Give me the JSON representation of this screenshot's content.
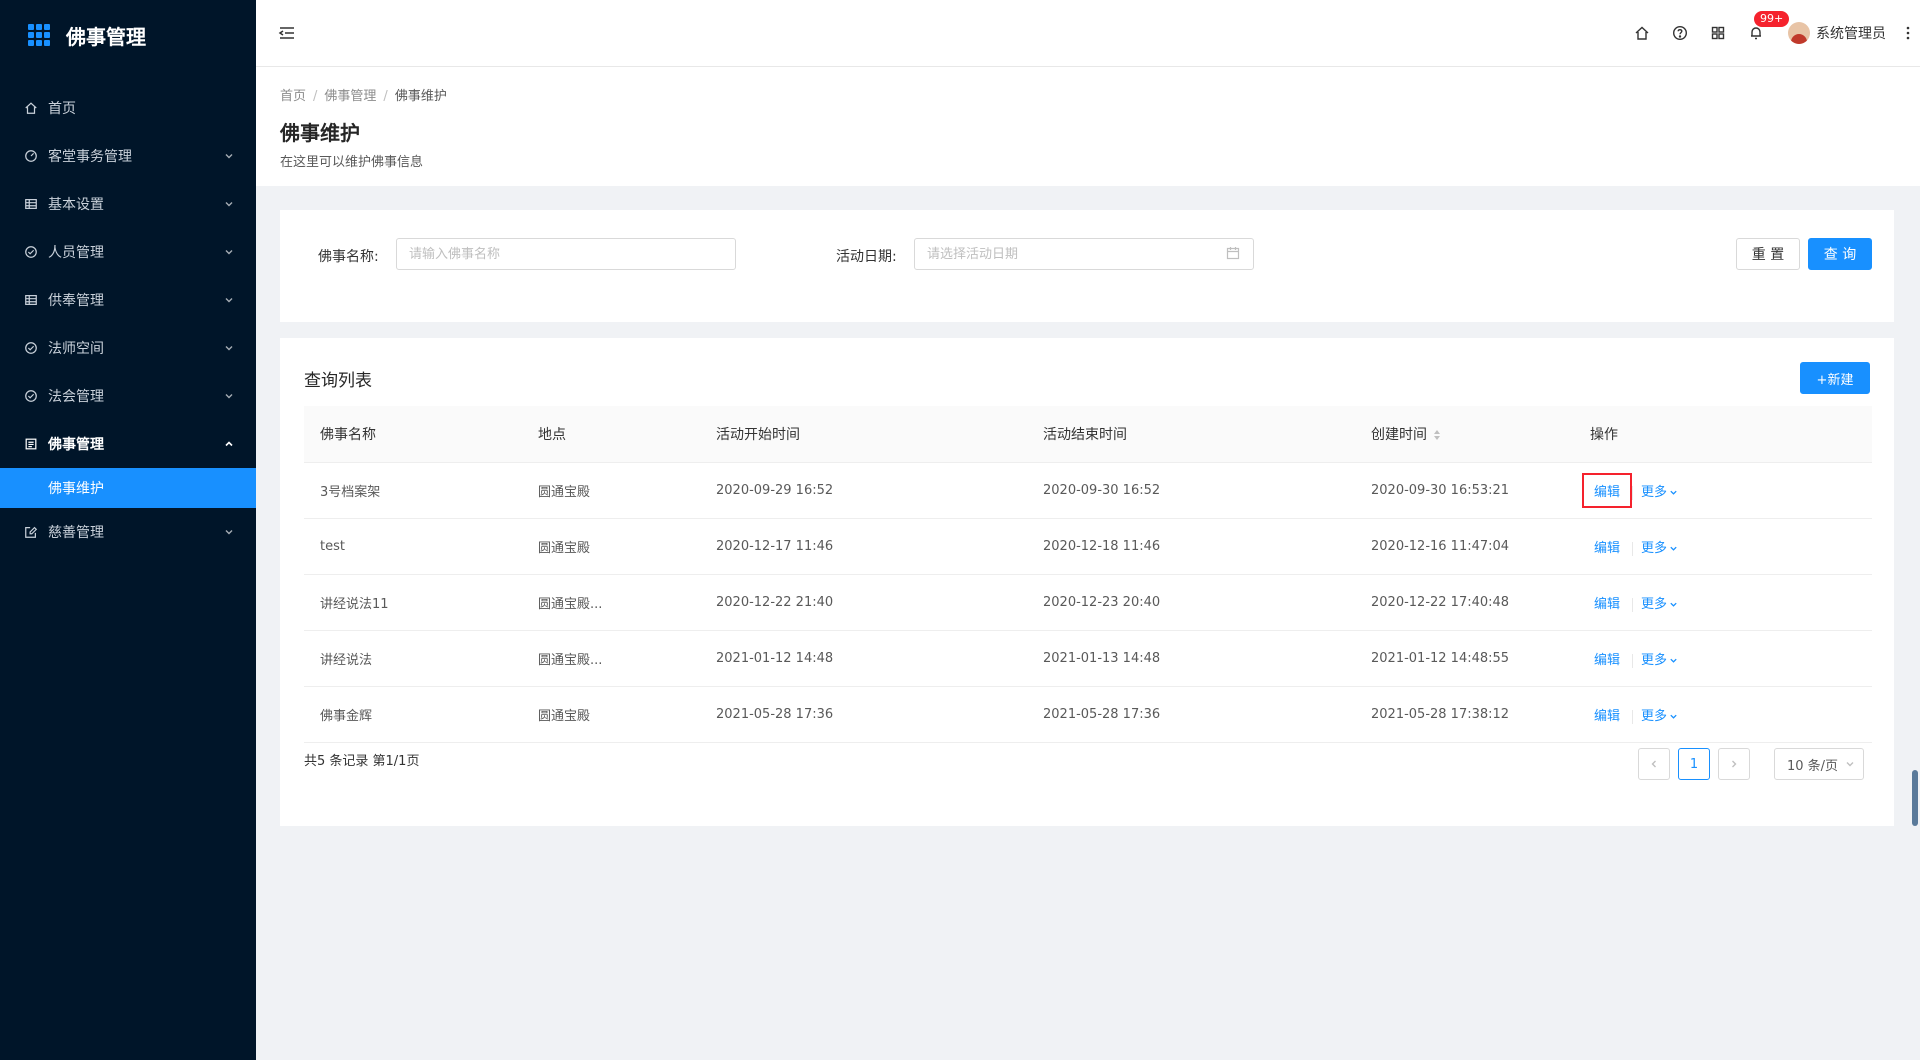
{
  "app": {
    "title": "佛事管理"
  },
  "sidebar": {
    "items": [
      {
        "label": "首页",
        "icon": "home-icon"
      },
      {
        "label": "客堂事务管理",
        "icon": "dashboard-icon"
      },
      {
        "label": "基本设置",
        "icon": "table-icon"
      },
      {
        "label": "人员管理",
        "icon": "check-circle-icon"
      },
      {
        "label": "供奉管理",
        "icon": "table-icon"
      },
      {
        "label": "法师空间",
        "icon": "check-circle-icon"
      },
      {
        "label": "法会管理",
        "icon": "check-circle-icon"
      },
      {
        "label": "佛事管理",
        "icon": "profile-icon"
      },
      {
        "label": "慈善管理",
        "icon": "form-icon"
      }
    ],
    "active_sub": "佛事维护"
  },
  "header": {
    "notifications_badge": "99+",
    "username": "系统管理员"
  },
  "page": {
    "breadcrumb": [
      "首页",
      "佛事管理",
      "佛事维护"
    ],
    "title": "佛事维护",
    "description": "在这里可以维护佛事信息"
  },
  "filter": {
    "name_label": "佛事名称:",
    "name_placeholder": "请输入佛事名称",
    "date_label": "活动日期:",
    "date_placeholder": "请选择活动日期",
    "reset_label": "重 置",
    "query_label": "查 询"
  },
  "table": {
    "title": "查询列表",
    "new_label": "+新建",
    "columns": [
      "佛事名称",
      "地点",
      "活动开始时间",
      "活动结束时间",
      "创建时间",
      "操作"
    ],
    "rows": [
      {
        "name": "3号档案架",
        "place": "圆通宝殿",
        "start": "2020-09-29 16:52",
        "end": "2020-09-30 16:52",
        "created": "2020-09-30 16:53:21"
      },
      {
        "name": "test",
        "place": "圆通宝殿",
        "start": "2020-12-17 11:46",
        "end": "2020-12-18 11:46",
        "created": "2020-12-16 11:47:04"
      },
      {
        "name": "讲经说法11",
        "place": "圆通宝殿...",
        "start": "2020-12-22 21:40",
        "end": "2020-12-23 20:40",
        "created": "2020-12-22 17:40:48"
      },
      {
        "name": "讲经说法",
        "place": "圆通宝殿...",
        "start": "2021-01-12 14:48",
        "end": "2021-01-13 14:48",
        "created": "2021-01-12 14:48:55"
      },
      {
        "name": "佛事金辉",
        "place": "圆通宝殿",
        "start": "2021-05-28 17:36",
        "end": "2021-05-28 17:36",
        "created": "2021-05-28 17:38:12"
      }
    ],
    "op_edit": "编辑",
    "op_more": "更多",
    "summary": "共5 条记录 第1/1页",
    "current_page": "1",
    "page_size": "10 条/页"
  },
  "colors": {
    "sidebar_bg": "#001529",
    "primary": "#1890ff",
    "highlight_box": "#f5222d"
  }
}
